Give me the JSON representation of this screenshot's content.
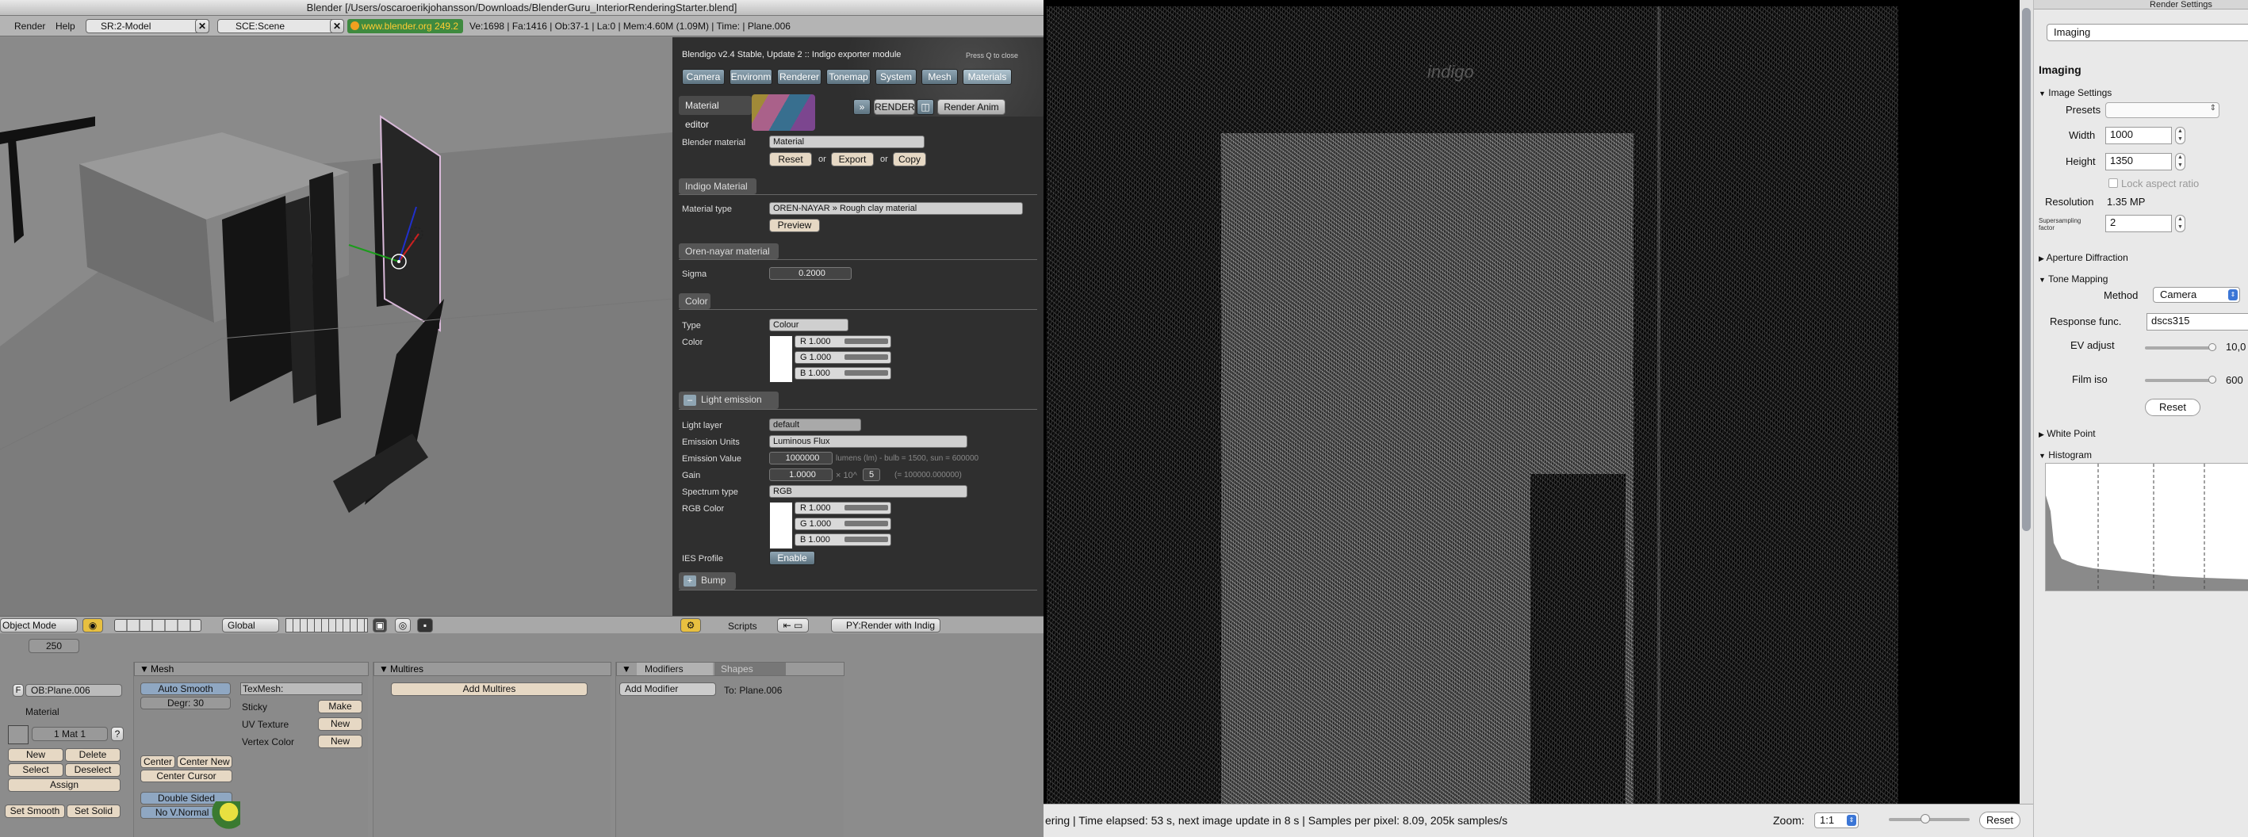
{
  "blender": {
    "title": "Blender [/Users/oscaroerikjohansson/Downloads/BlenderGuru_InteriorRenderingStarter.blend]",
    "menu": [
      "Render",
      "Help"
    ],
    "screen": "SR:2-Model",
    "scene": "SCE:Scene",
    "website": "www.blender.org 249.2",
    "stats": "Ve:1698 | Fa:1416 | Ob:37-1 | La:0  | Mem:4.60M (1.09M) | Time: | Plane.006",
    "viewport_header": {
      "mode": "Object Mode",
      "orientation": "Global"
    },
    "buttons_header": {
      "frame": "250"
    },
    "editing": {
      "object_name": "OB:Plane.006",
      "f_label": "F",
      "material_label": "Material",
      "mat_counter": "1 Mat 1",
      "question": "?",
      "new": "New",
      "delete": "Delete",
      "select": "Select",
      "deselect": "Deselect",
      "assign": "Assign",
      "set_smooth": "Set Smooth",
      "set_solid": "Set Solid",
      "mesh_panel": "Mesh",
      "auto_smooth": "Auto Smooth",
      "degr": "Degr: 30",
      "texmesh": "TexMesh:",
      "sticky": "Sticky",
      "make": "Make",
      "uv_texture": "UV Texture",
      "uv_new": "New",
      "vertex_color": "Vertex Color",
      "vc_new": "New",
      "center": "Center",
      "center_new": "Center New",
      "center_cursor": "Center Cursor",
      "double_sided": "Double Sided",
      "no_vnormal": "No V.Normal F",
      "multires_panel": "Multires",
      "add_multires": "Add Multires",
      "modifiers_tab": "Modifiers",
      "shapes_tab": "Shapes",
      "add_modifier": "Add Modifier",
      "to_plane": "To: Plane.006"
    },
    "scripts_header": {
      "scripts": "Scripts",
      "script_name": "PY:Render with Indig"
    }
  },
  "indigo": {
    "header": "Blendigo  v2.4 Stable, Update 2  ::  Indigo exporter module",
    "quit_hint": "Press Q to close",
    "tabs": [
      "Camera",
      "Environm",
      "Renderer",
      "Tonemap",
      "System",
      "Mesh",
      "Materials"
    ],
    "material_editor": "Material editor",
    "render": "RENDER",
    "render_anim": "Render Anim",
    "blender_material_label": "Blender material",
    "blender_material": "Material",
    "reset": "Reset",
    "or1": "or",
    "export": "Export",
    "or2": "or",
    "copy": "Copy",
    "indigo_material_section": "Indigo Material",
    "material_type_label": "Material type",
    "material_type": "OREN-NAYAR » Rough clay material",
    "preview": "Preview",
    "oren_section": "Oren-nayar material",
    "sigma_label": "Sigma",
    "sigma_value": "0.2000",
    "color_section": "Color",
    "type_label": "Type",
    "type_value": "Colour",
    "color_label": "Color",
    "color_r": "R 1.000",
    "color_g": "G 1.000",
    "color_b": "B 1.000",
    "light_emission_section": "Light emission",
    "light_layer_label": "Light layer",
    "light_layer": "default",
    "emission_units_label": "Emission Units",
    "emission_units": "Luminous Flux",
    "emission_value_label": "Emission Value",
    "emission_value": "1000000",
    "emission_hint": "lumens (lm) - bulb = 1500, sun = 600000",
    "gain_label": "Gain",
    "gain_value": "1.0000",
    "gain_exp_label": "× 10^",
    "gain_exp": "5",
    "gain_result": "(= 100000.000000)",
    "spectrum_label": "Spectrum type",
    "spectrum": "RGB",
    "rgb_label": "RGB Color",
    "rgb_r": "R 1.000",
    "rgb_g": "G 1.000",
    "rgb_b": "B 1.000",
    "ies_label": "IES Profile",
    "enable": "Enable",
    "bump_section": "Bump",
    "watermark": "indigo"
  },
  "render_window": {
    "status": "ering | Time elapsed: 53 s, next image update in 8 s | Samples per pixel: 8.09, 205k samples/s",
    "zoom_label": "Zoom:",
    "zoom_value": "1:1",
    "reset": "Reset"
  },
  "render_settings": {
    "title": "Render Settings",
    "dropdown": "Imaging",
    "heading": "Imaging",
    "image_settings": "Image Settings",
    "presets_label": "Presets",
    "width_label": "Width",
    "width": "1000",
    "height_label": "Height",
    "height": "1350",
    "lock_aspect": "Lock aspect ratio",
    "resolution_label": "Resolution",
    "resolution": "1.35 MP",
    "supersampling_label": "Supersampling factor",
    "supersampling": "2",
    "aperture": "Aperture Diffraction",
    "tone_mapping": "Tone Mapping",
    "method_label": "Method",
    "method": "Camera",
    "response_label": "Response func.",
    "response": "dscs315",
    "ev_label": "EV adjust",
    "ev_value": "10,0",
    "film_label": "Film iso",
    "film_value": "600",
    "reset": "Reset",
    "white_point": "White Point",
    "histogram": "Histogram"
  }
}
